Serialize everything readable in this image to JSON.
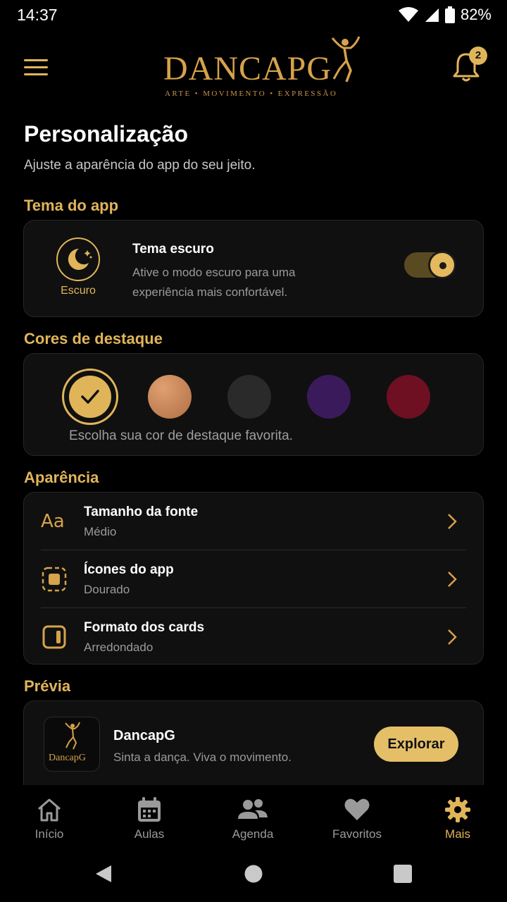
{
  "status": {
    "time": "14:37",
    "battery": "82%"
  },
  "header": {
    "logo_text": "DANCAPG",
    "logo_tagline": "ARTE • MOVIMENTO • EXPRESSÃO",
    "notification_count": "2"
  },
  "page": {
    "title": "Personalização",
    "subtitle": "Ajuste a aparência do app do seu jeito."
  },
  "theme": {
    "section_title": "Tema do app",
    "icon_label": "Escuro",
    "title": "Tema escuro",
    "description": "Ative o modo escuro para uma experiência mais confortável.",
    "enabled": true
  },
  "accent": {
    "section_title": "Cores de destaque",
    "hint": "Escolha sua cor de destaque favorita.",
    "colors": [
      "#e0b55a",
      "#c98a5c",
      "#2a2a2a",
      "#3b1a5c",
      "#6e0f22"
    ],
    "selected_index": 0
  },
  "appearance": {
    "section_title": "Aparência",
    "font_icon_glyph": "Aa",
    "rows": [
      {
        "title": "Tamanho da fonte",
        "value": "Médio",
        "icon": "font-size-icon"
      },
      {
        "title": "Ícones do app",
        "value": "Dourado",
        "icon": "app-icons-icon"
      },
      {
        "title": "Formato dos cards",
        "value": "Arredondado",
        "icon": "card-shape-icon"
      }
    ]
  },
  "preview": {
    "section_title": "Prévia",
    "logo_text": "DancapG",
    "title": "DancapG",
    "subtitle": "Sinta a dança. Viva o movimento.",
    "button": "Explorar"
  },
  "nav": {
    "items": [
      {
        "label": "Início",
        "icon": "home-icon"
      },
      {
        "label": "Aulas",
        "icon": "calendar-icon"
      },
      {
        "label": "Agenda",
        "icon": "people-icon"
      },
      {
        "label": "Favoritos",
        "icon": "heart-icon"
      },
      {
        "label": "Mais",
        "icon": "gear-icon"
      }
    ],
    "active_index": 4
  }
}
